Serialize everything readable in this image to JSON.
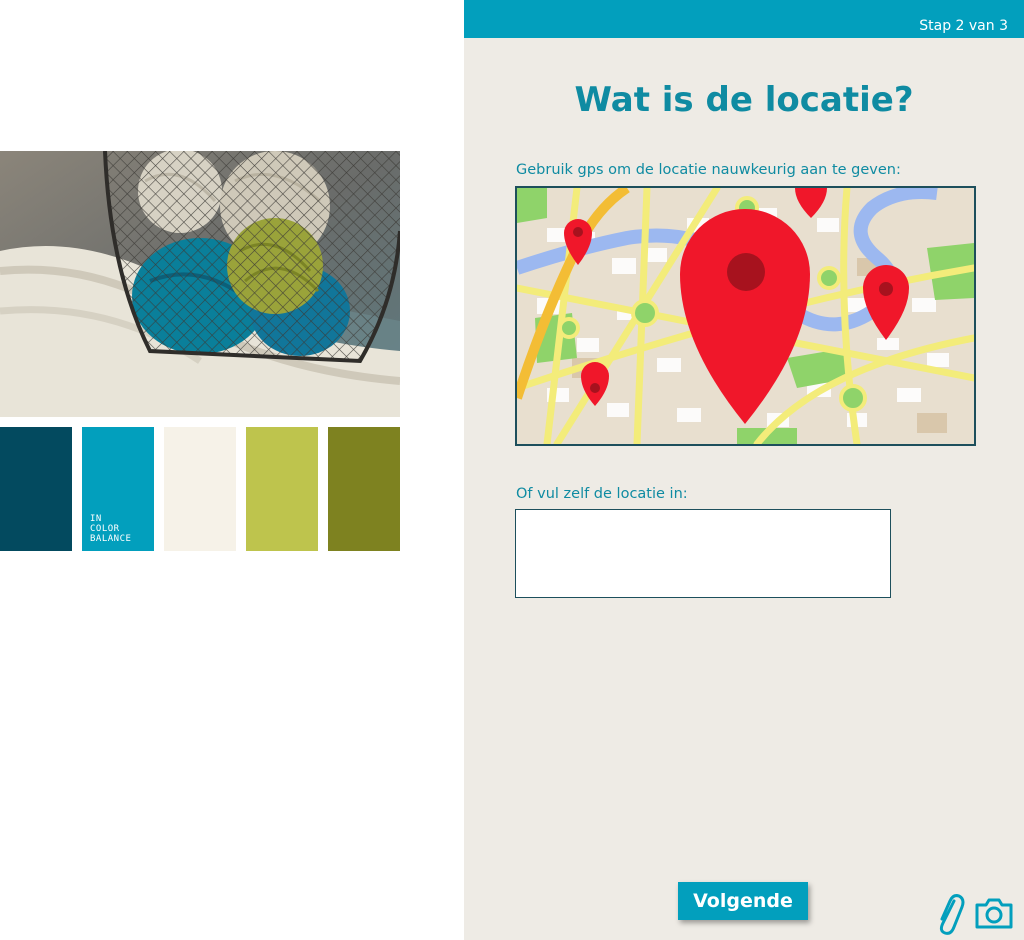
{
  "palette": {
    "swatches": [
      {
        "color": "#034a5f",
        "label": ""
      },
      {
        "color": "#029fbd",
        "label": "IN\nCOLOR\nBALANCE"
      },
      {
        "color": "#f6f2e8",
        "label": ""
      },
      {
        "color": "#bec44d",
        "label": ""
      },
      {
        "color": "#7e8220",
        "label": ""
      }
    ]
  },
  "header": {
    "step": "Stap 2 van 3"
  },
  "main": {
    "title": "Wat is de locatie?",
    "gps_label": "Gebruik gps om de locatie nauwkeurig aan te geven:",
    "manual_label": "Of vul zelf de locatie in:",
    "location_value": "",
    "location_placeholder": ""
  },
  "footer": {
    "next_label": "Volgende",
    "attach_icon": "paperclip-icon",
    "camera_icon": "camera-icon"
  },
  "colors": {
    "accent": "#029fbd",
    "title": "#0f8ba2",
    "panel_bg": "#eeebe5",
    "pin_red": "#f0172a"
  }
}
